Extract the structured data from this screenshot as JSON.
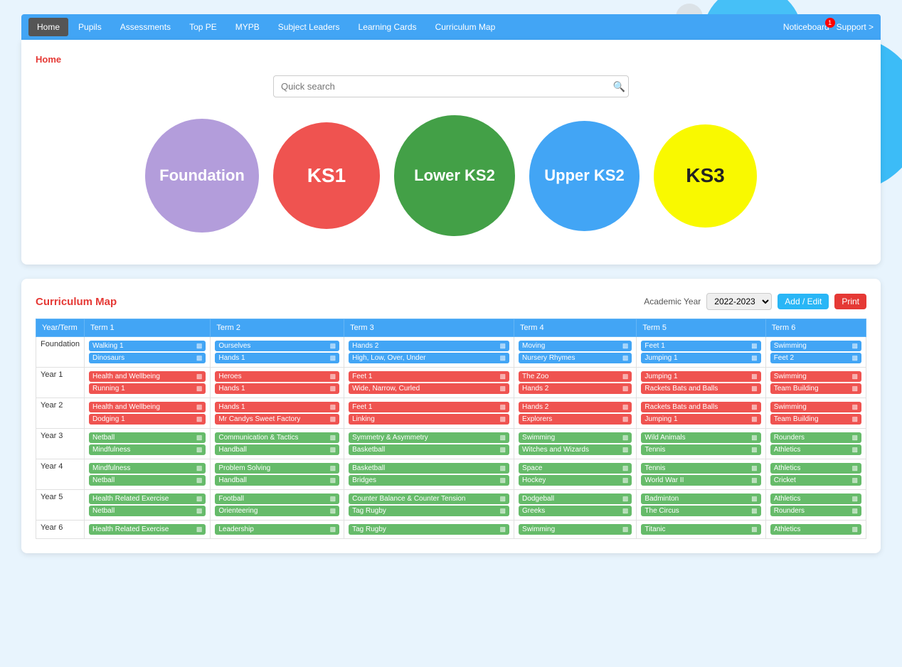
{
  "bg": {
    "circles": [
      "large-blue",
      "medium-blue",
      "dot-gray-1",
      "dot-gray-2",
      "dot-gray-3",
      "dot-gray-4"
    ]
  },
  "navbar": {
    "items": [
      {
        "label": "Home",
        "active": true
      },
      {
        "label": "Pupils",
        "active": false
      },
      {
        "label": "Assessments",
        "active": false
      },
      {
        "label": "Top PE",
        "active": false
      },
      {
        "label": "MYPB",
        "active": false
      },
      {
        "label": "Subject Leaders",
        "active": false
      },
      {
        "label": "Learning Cards",
        "active": false
      },
      {
        "label": "Curriculum Map",
        "active": false
      }
    ],
    "noticeboard_label": "Noticeboard",
    "noticeboard_count": "1",
    "support_label": "Support >"
  },
  "breadcrumb": "Home",
  "search": {
    "placeholder": "Quick search"
  },
  "ks_circles": [
    {
      "label": "Foundation",
      "class": "foundation"
    },
    {
      "label": "KS1",
      "class": "ks1"
    },
    {
      "label": "Lower KS2",
      "class": "lower-ks2"
    },
    {
      "label": "Upper KS2",
      "class": "upper-ks2"
    },
    {
      "label": "KS3",
      "class": "ks3"
    }
  ],
  "curriculum": {
    "title": "Curriculum Map",
    "academic_year_label": "Academic Year",
    "academic_year_value": "2022-2023",
    "add_edit_label": "Add / Edit",
    "print_label": "Print",
    "headers": [
      "Year/Term",
      "Term 1",
      "Term 2",
      "Term 3",
      "Term 4",
      "Term 5",
      "Term 6"
    ],
    "rows": [
      {
        "year": "Foundation",
        "terms": [
          [
            {
              "label": "Walking 1",
              "color": "blue"
            },
            {
              "label": "Dinosaurs",
              "color": "blue"
            }
          ],
          [
            {
              "label": "Ourselves",
              "color": "blue"
            },
            {
              "label": "Hands 1",
              "color": "blue"
            }
          ],
          [
            {
              "label": "Hands 2",
              "color": "blue"
            },
            {
              "label": "High, Low, Over, Under",
              "color": "blue"
            }
          ],
          [
            {
              "label": "Moving",
              "color": "blue"
            },
            {
              "label": "Nursery Rhymes",
              "color": "blue"
            }
          ],
          [
            {
              "label": "Feet 1",
              "color": "blue"
            },
            {
              "label": "Jumping 1",
              "color": "blue"
            }
          ],
          [
            {
              "label": "Swimming",
              "color": "blue"
            },
            {
              "label": "Feet 2",
              "color": "blue"
            }
          ]
        ]
      },
      {
        "year": "Year 1",
        "terms": [
          [
            {
              "label": "Health and Wellbeing",
              "color": "red"
            },
            {
              "label": "Running 1",
              "color": "red"
            }
          ],
          [
            {
              "label": "Heroes",
              "color": "red"
            },
            {
              "label": "Hands 1",
              "color": "red"
            }
          ],
          [
            {
              "label": "Feet 1",
              "color": "red"
            },
            {
              "label": "Wide, Narrow, Curled",
              "color": "red"
            }
          ],
          [
            {
              "label": "The Zoo",
              "color": "red"
            },
            {
              "label": "Hands 2",
              "color": "red"
            }
          ],
          [
            {
              "label": "Jumping 1",
              "color": "red"
            },
            {
              "label": "Rackets Bats and Balls",
              "color": "red"
            }
          ],
          [
            {
              "label": "Swimming",
              "color": "red"
            },
            {
              "label": "Team Building",
              "color": "red"
            }
          ]
        ]
      },
      {
        "year": "Year 2",
        "terms": [
          [
            {
              "label": "Health and Wellbeing",
              "color": "red"
            },
            {
              "label": "Dodging 1",
              "color": "red"
            }
          ],
          [
            {
              "label": "Hands 1",
              "color": "red"
            },
            {
              "label": "Mr Candys Sweet Factory",
              "color": "red"
            }
          ],
          [
            {
              "label": "Feet 1",
              "color": "red"
            },
            {
              "label": "Linking",
              "color": "red"
            }
          ],
          [
            {
              "label": "Hands 2",
              "color": "red"
            },
            {
              "label": "Explorers",
              "color": "red"
            }
          ],
          [
            {
              "label": "Rackets Bats and Balls",
              "color": "red"
            },
            {
              "label": "Jumping 1",
              "color": "red"
            }
          ],
          [
            {
              "label": "Swimming",
              "color": "red"
            },
            {
              "label": "Team Building",
              "color": "red"
            }
          ]
        ]
      },
      {
        "year": "Year 3",
        "terms": [
          [
            {
              "label": "Netball",
              "color": "green"
            },
            {
              "label": "Mindfulness",
              "color": "green"
            }
          ],
          [
            {
              "label": "Communication & Tactics",
              "color": "green"
            },
            {
              "label": "Handball",
              "color": "green"
            }
          ],
          [
            {
              "label": "Symmetry & Asymmetry",
              "color": "green"
            },
            {
              "label": "Basketball",
              "color": "green"
            }
          ],
          [
            {
              "label": "Swimming",
              "color": "green"
            },
            {
              "label": "Witches and Wizards",
              "color": "green"
            }
          ],
          [
            {
              "label": "Wild Animals",
              "color": "green"
            },
            {
              "label": "Tennis",
              "color": "green"
            }
          ],
          [
            {
              "label": "Rounders",
              "color": "green"
            },
            {
              "label": "Athletics",
              "color": "green"
            }
          ]
        ]
      },
      {
        "year": "Year 4",
        "terms": [
          [
            {
              "label": "Mindfulness",
              "color": "green"
            },
            {
              "label": "Netball",
              "color": "green"
            }
          ],
          [
            {
              "label": "Problem Solving",
              "color": "green"
            },
            {
              "label": "Handball",
              "color": "green"
            }
          ],
          [
            {
              "label": "Basketball",
              "color": "green"
            },
            {
              "label": "Bridges",
              "color": "green"
            }
          ],
          [
            {
              "label": "Space",
              "color": "green"
            },
            {
              "label": "Hockey",
              "color": "green"
            }
          ],
          [
            {
              "label": "Tennis",
              "color": "green"
            },
            {
              "label": "World War II",
              "color": "green"
            }
          ],
          [
            {
              "label": "Athletics",
              "color": "green"
            },
            {
              "label": "Cricket",
              "color": "green"
            }
          ]
        ]
      },
      {
        "year": "Year 5",
        "terms": [
          [
            {
              "label": "Health Related Exercise",
              "color": "green"
            },
            {
              "label": "Netball",
              "color": "green"
            }
          ],
          [
            {
              "label": "Football",
              "color": "green"
            },
            {
              "label": "Orienteering",
              "color": "green"
            }
          ],
          [
            {
              "label": "Counter Balance & Counter Tension",
              "color": "green"
            },
            {
              "label": "Tag Rugby",
              "color": "green"
            }
          ],
          [
            {
              "label": "Dodgeball",
              "color": "green"
            },
            {
              "label": "Greeks",
              "color": "green"
            }
          ],
          [
            {
              "label": "Badminton",
              "color": "green"
            },
            {
              "label": "The Circus",
              "color": "green"
            }
          ],
          [
            {
              "label": "Athletics",
              "color": "green"
            },
            {
              "label": "Rounders",
              "color": "green"
            }
          ]
        ]
      },
      {
        "year": "Year 6",
        "terms": [
          [
            {
              "label": "Health Related Exercise",
              "color": "green"
            }
          ],
          [
            {
              "label": "Leadership",
              "color": "green"
            }
          ],
          [
            {
              "label": "Tag Rugby",
              "color": "green"
            }
          ],
          [
            {
              "label": "Swimming",
              "color": "green"
            }
          ],
          [
            {
              "label": "Titanic",
              "color": "green"
            }
          ],
          [
            {
              "label": "Athletics",
              "color": "green"
            }
          ]
        ]
      }
    ]
  }
}
